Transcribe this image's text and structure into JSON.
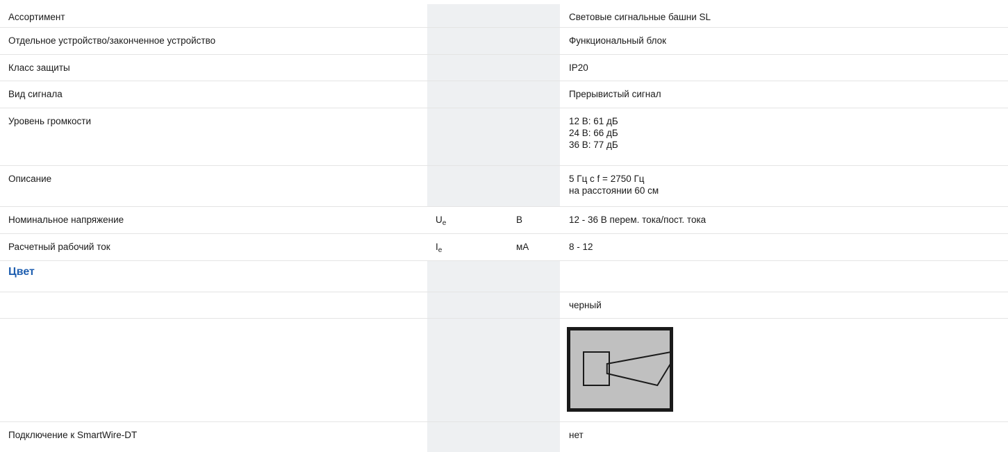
{
  "rows": [
    {
      "label": "Ассортимент",
      "symbol": "",
      "unit": "",
      "values": [
        "Световые сигнальные башни SL"
      ]
    },
    {
      "label": "Отдельное устройство/законченное устройство",
      "symbol": "",
      "unit": "",
      "values": [
        "Функциональный блок"
      ]
    },
    {
      "label": "Класс защиты",
      "symbol": "",
      "unit": "",
      "values": [
        "IP20"
      ]
    },
    {
      "label": "Вид сигнала",
      "symbol": "",
      "unit": "",
      "values": [
        "Прерывистый сигнал"
      ]
    },
    {
      "label": "Уровень громкости",
      "symbol": "",
      "unit": "",
      "values": [
        "12 В: 61 дБ",
        "24 В: 66 дБ",
        "36 В: 77 дБ"
      ]
    },
    {
      "label": "Описание",
      "symbol": "",
      "unit": "",
      "values": [
        "5 Гц с f = 2750 Гц",
        "на расстоянии 60 см"
      ]
    },
    {
      "label": "Номинальное напряжение",
      "symbol": "U",
      "symbol_sub": "e",
      "unit": "В",
      "values": [
        "12 - 36 В перем. тока/пост. тока"
      ]
    },
    {
      "label": "Расчетный рабочий ток",
      "symbol": "I",
      "symbol_sub": "e",
      "unit": "мА",
      "values": [
        "8 - 12"
      ]
    }
  ],
  "section": {
    "title": "Цвет"
  },
  "color_row": {
    "value": "черный"
  },
  "symbol_row": {
    "icon": "horn-signal-icon",
    "fill": "#c0c0c0",
    "stroke": "#1a1a1a"
  },
  "last_row": {
    "label": "Подключение к SmartWire-DT",
    "value": "нет"
  }
}
